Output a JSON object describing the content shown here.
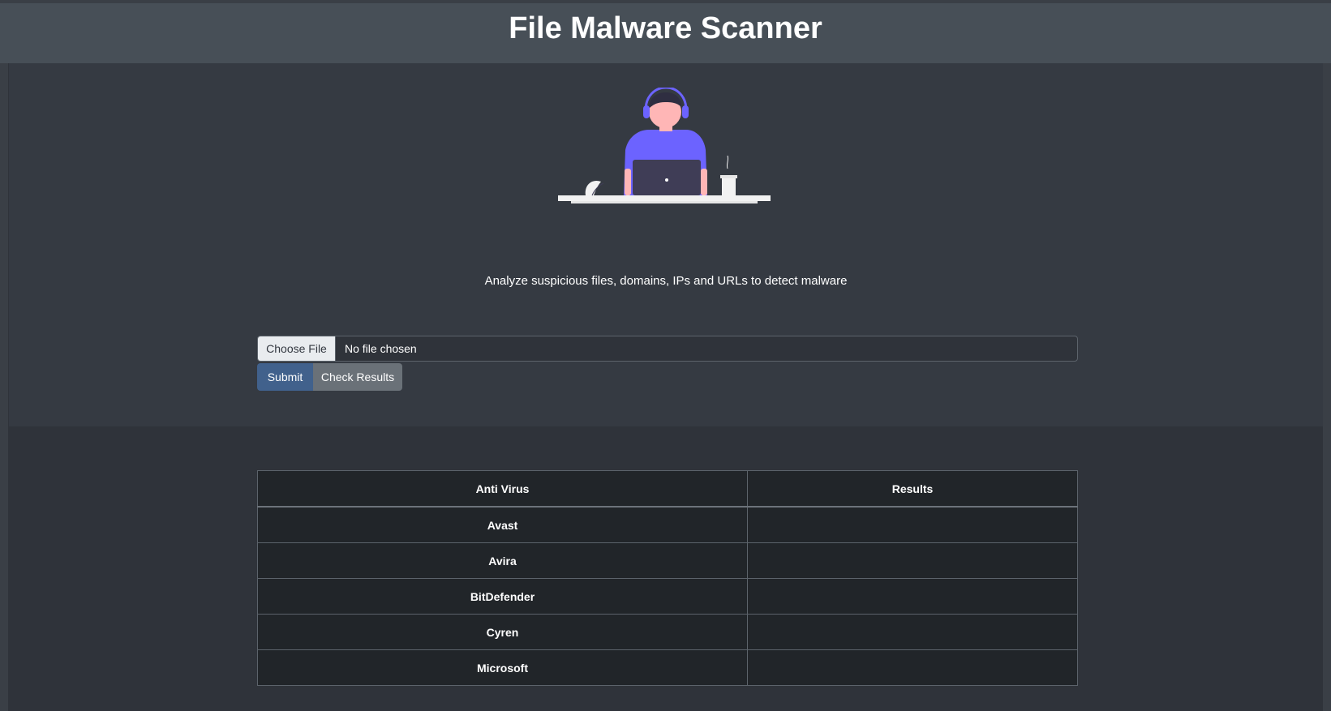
{
  "header": {
    "title": "File Malware Scanner"
  },
  "hero": {
    "tagline": "Analyze suspicious files, domains, IPs and URLs to detect malware"
  },
  "upload": {
    "choose_label": "Choose File",
    "file_status": "No file chosen",
    "submit_label": "Submit",
    "check_label": "Check Results"
  },
  "results": {
    "columns": [
      "Anti Virus",
      "Results"
    ],
    "rows": [
      {
        "av": "Avast",
        "result": ""
      },
      {
        "av": "Avira",
        "result": ""
      },
      {
        "av": "BitDefender",
        "result": ""
      },
      {
        "av": "Cyren",
        "result": ""
      },
      {
        "av": "Microsoft",
        "result": ""
      }
    ]
  },
  "colors": {
    "header_bg": "#474f57",
    "hero_bg": "#353a42",
    "page_bg": "#2f333a",
    "table_bg": "#212529",
    "submit_bg": "#41618c",
    "check_bg": "#6a7178",
    "accent_purple": "#6c63ff"
  }
}
